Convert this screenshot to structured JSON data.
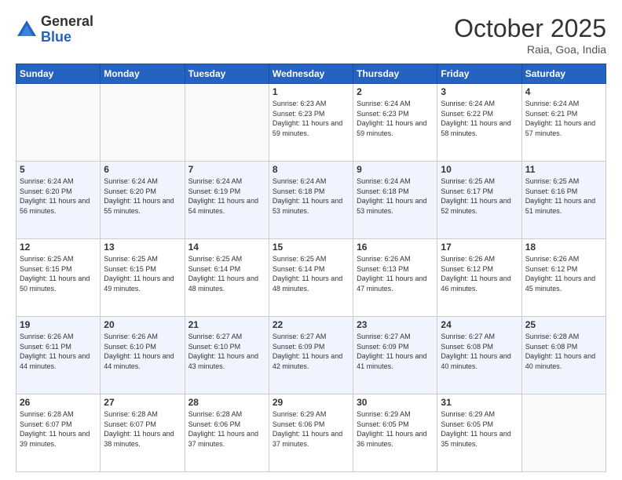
{
  "header": {
    "logo_general": "General",
    "logo_blue": "Blue",
    "month_title": "October 2025",
    "location": "Raia, Goa, India"
  },
  "weekdays": [
    "Sunday",
    "Monday",
    "Tuesday",
    "Wednesday",
    "Thursday",
    "Friday",
    "Saturday"
  ],
  "weeks": [
    [
      {
        "day": "",
        "info": ""
      },
      {
        "day": "",
        "info": ""
      },
      {
        "day": "",
        "info": ""
      },
      {
        "day": "1",
        "info": "Sunrise: 6:23 AM\nSunset: 6:23 PM\nDaylight: 11 hours\nand 59 minutes."
      },
      {
        "day": "2",
        "info": "Sunrise: 6:24 AM\nSunset: 6:23 PM\nDaylight: 11 hours\nand 59 minutes."
      },
      {
        "day": "3",
        "info": "Sunrise: 6:24 AM\nSunset: 6:22 PM\nDaylight: 11 hours\nand 58 minutes."
      },
      {
        "day": "4",
        "info": "Sunrise: 6:24 AM\nSunset: 6:21 PM\nDaylight: 11 hours\nand 57 minutes."
      }
    ],
    [
      {
        "day": "5",
        "info": "Sunrise: 6:24 AM\nSunset: 6:20 PM\nDaylight: 11 hours\nand 56 minutes."
      },
      {
        "day": "6",
        "info": "Sunrise: 6:24 AM\nSunset: 6:20 PM\nDaylight: 11 hours\nand 55 minutes."
      },
      {
        "day": "7",
        "info": "Sunrise: 6:24 AM\nSunset: 6:19 PM\nDaylight: 11 hours\nand 54 minutes."
      },
      {
        "day": "8",
        "info": "Sunrise: 6:24 AM\nSunset: 6:18 PM\nDaylight: 11 hours\nand 53 minutes."
      },
      {
        "day": "9",
        "info": "Sunrise: 6:24 AM\nSunset: 6:18 PM\nDaylight: 11 hours\nand 53 minutes."
      },
      {
        "day": "10",
        "info": "Sunrise: 6:25 AM\nSunset: 6:17 PM\nDaylight: 11 hours\nand 52 minutes."
      },
      {
        "day": "11",
        "info": "Sunrise: 6:25 AM\nSunset: 6:16 PM\nDaylight: 11 hours\nand 51 minutes."
      }
    ],
    [
      {
        "day": "12",
        "info": "Sunrise: 6:25 AM\nSunset: 6:15 PM\nDaylight: 11 hours\nand 50 minutes."
      },
      {
        "day": "13",
        "info": "Sunrise: 6:25 AM\nSunset: 6:15 PM\nDaylight: 11 hours\nand 49 minutes."
      },
      {
        "day": "14",
        "info": "Sunrise: 6:25 AM\nSunset: 6:14 PM\nDaylight: 11 hours\nand 48 minutes."
      },
      {
        "day": "15",
        "info": "Sunrise: 6:25 AM\nSunset: 6:14 PM\nDaylight: 11 hours\nand 48 minutes."
      },
      {
        "day": "16",
        "info": "Sunrise: 6:26 AM\nSunset: 6:13 PM\nDaylight: 11 hours\nand 47 minutes."
      },
      {
        "day": "17",
        "info": "Sunrise: 6:26 AM\nSunset: 6:12 PM\nDaylight: 11 hours\nand 46 minutes."
      },
      {
        "day": "18",
        "info": "Sunrise: 6:26 AM\nSunset: 6:12 PM\nDaylight: 11 hours\nand 45 minutes."
      }
    ],
    [
      {
        "day": "19",
        "info": "Sunrise: 6:26 AM\nSunset: 6:11 PM\nDaylight: 11 hours\nand 44 minutes."
      },
      {
        "day": "20",
        "info": "Sunrise: 6:26 AM\nSunset: 6:10 PM\nDaylight: 11 hours\nand 44 minutes."
      },
      {
        "day": "21",
        "info": "Sunrise: 6:27 AM\nSunset: 6:10 PM\nDaylight: 11 hours\nand 43 minutes."
      },
      {
        "day": "22",
        "info": "Sunrise: 6:27 AM\nSunset: 6:09 PM\nDaylight: 11 hours\nand 42 minutes."
      },
      {
        "day": "23",
        "info": "Sunrise: 6:27 AM\nSunset: 6:09 PM\nDaylight: 11 hours\nand 41 minutes."
      },
      {
        "day": "24",
        "info": "Sunrise: 6:27 AM\nSunset: 6:08 PM\nDaylight: 11 hours\nand 40 minutes."
      },
      {
        "day": "25",
        "info": "Sunrise: 6:28 AM\nSunset: 6:08 PM\nDaylight: 11 hours\nand 40 minutes."
      }
    ],
    [
      {
        "day": "26",
        "info": "Sunrise: 6:28 AM\nSunset: 6:07 PM\nDaylight: 11 hours\nand 39 minutes."
      },
      {
        "day": "27",
        "info": "Sunrise: 6:28 AM\nSunset: 6:07 PM\nDaylight: 11 hours\nand 38 minutes."
      },
      {
        "day": "28",
        "info": "Sunrise: 6:28 AM\nSunset: 6:06 PM\nDaylight: 11 hours\nand 37 minutes."
      },
      {
        "day": "29",
        "info": "Sunrise: 6:29 AM\nSunset: 6:06 PM\nDaylight: 11 hours\nand 37 minutes."
      },
      {
        "day": "30",
        "info": "Sunrise: 6:29 AM\nSunset: 6:05 PM\nDaylight: 11 hours\nand 36 minutes."
      },
      {
        "day": "31",
        "info": "Sunrise: 6:29 AM\nSunset: 6:05 PM\nDaylight: 11 hours\nand 35 minutes."
      },
      {
        "day": "",
        "info": ""
      }
    ]
  ]
}
